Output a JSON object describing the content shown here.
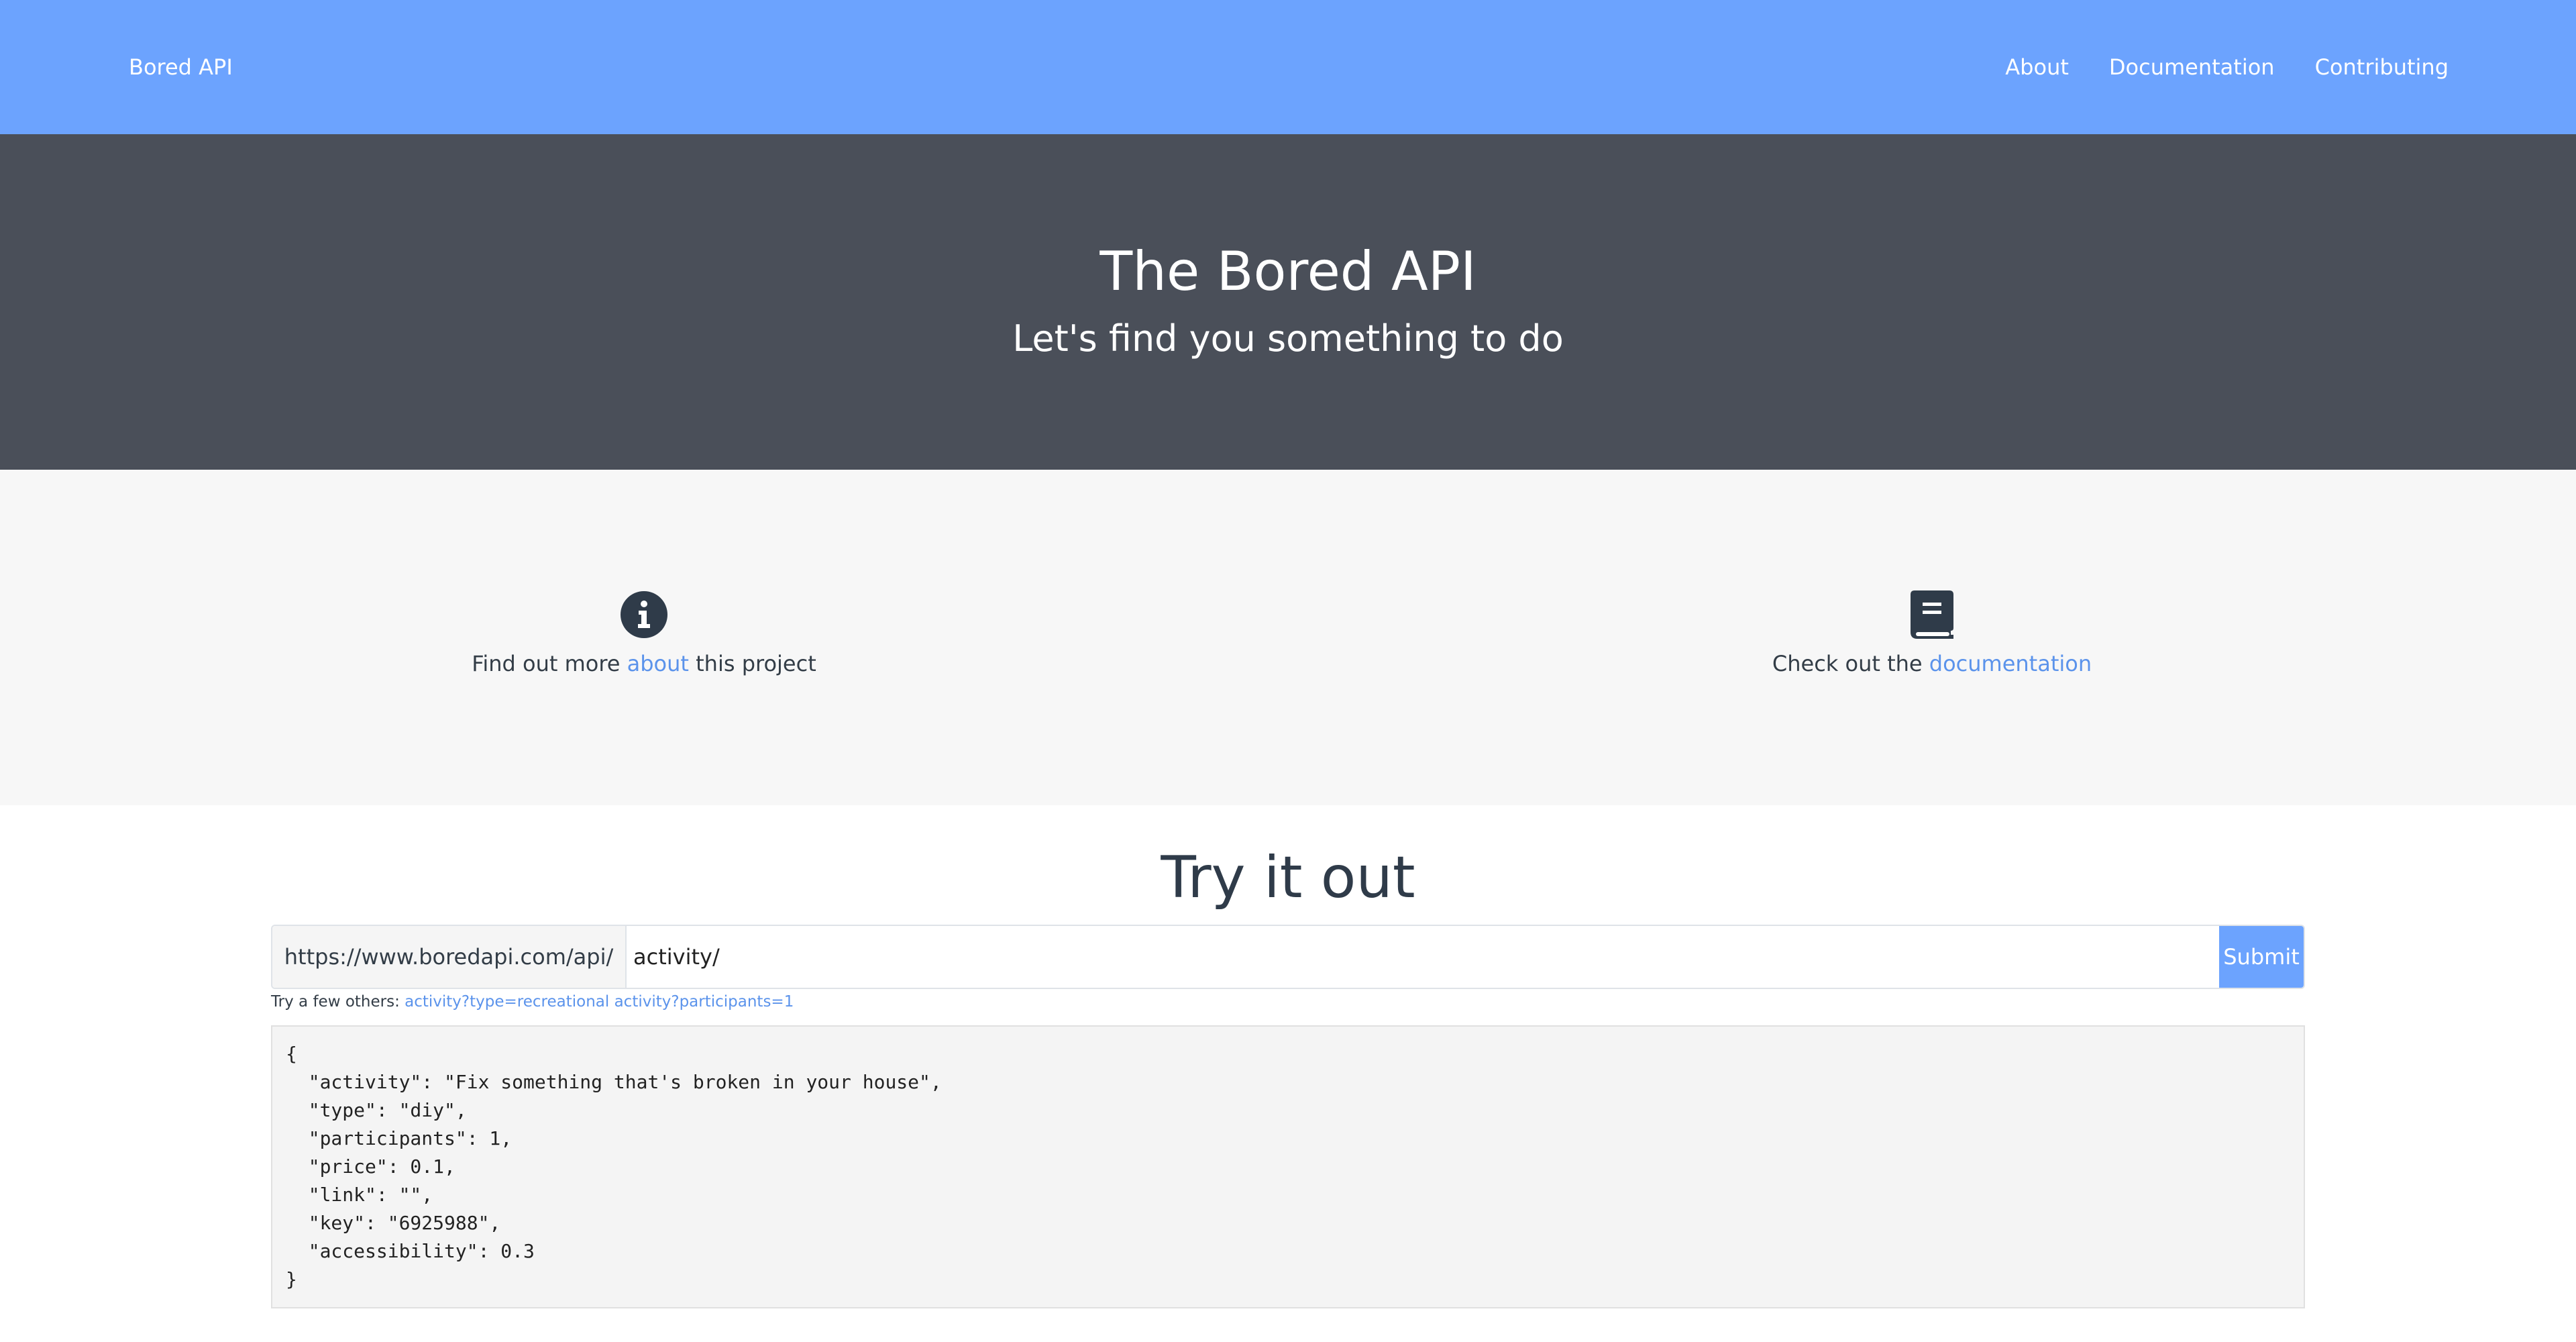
{
  "navbar": {
    "brand": "Bored API",
    "links": [
      "About",
      "Documentation",
      "Contributing"
    ]
  },
  "hero": {
    "title": "The Bored API",
    "subtitle": "Let's find you something to do"
  },
  "features": {
    "left": {
      "icon": "info-circle-icon",
      "prefix": "Find out more ",
      "link": "about",
      "suffix": " this project"
    },
    "right": {
      "icon": "book-icon",
      "prefix": "Check out the ",
      "link": "documentation"
    }
  },
  "try": {
    "title": "Try it out",
    "base_url": "https://www.boredapi.com/api/",
    "input_value": "activity/",
    "submit_label": "Submit",
    "hint_prefix": "Try a few others: ",
    "examples": [
      "activity?type=recreational",
      "activity?participants=1"
    ],
    "result": "{\n  \"activity\": \"Fix something that's broken in your house\",\n  \"type\": \"diy\",\n  \"participants\": 1,\n  \"price\": 0.1,\n  \"link\": \"\",\n  \"key\": \"6925988\",\n  \"accessibility\": 0.3\n}"
  },
  "colors": {
    "navbar": "#6ca3fe",
    "hero": "#4a4f59",
    "link": "#5b93eb",
    "text": "#333d47"
  }
}
